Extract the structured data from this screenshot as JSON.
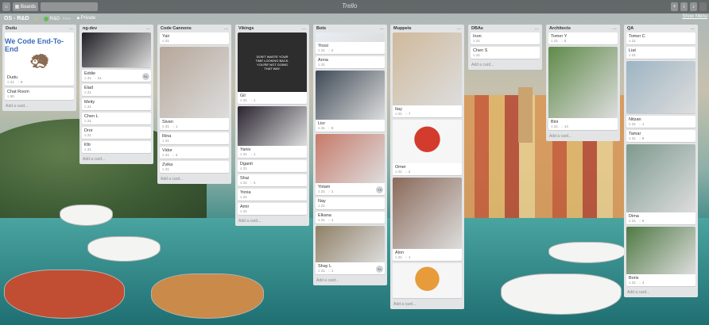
{
  "header": {
    "boards_label": "Boards",
    "logo": "Trello",
    "right_icons": [
      "plus-icon",
      "info-icon",
      "bell-icon",
      "avatar"
    ]
  },
  "board": {
    "title": "OS - R&D",
    "team_label": "R&D",
    "team_plan": "Free",
    "visibility": "Private",
    "show_menu": "Show Menu"
  },
  "lists": [
    {
      "name": "Dudu",
      "cards": [
        {
          "title": "Dudu",
          "badges": [
            "21",
            "9"
          ],
          "cover": {
            "type": "text",
            "text": "We Code End-To-End",
            "height": 0
          }
        },
        {
          "title": "Chat Room",
          "badges": [
            "50"
          ]
        }
      ],
      "add": "Add a card..."
    },
    {
      "name": "ng-dev",
      "cards": [
        {
          "title": "",
          "badges": [],
          "cover": {
            "type": "image",
            "color": "#1f1f24"
          }
        },
        {
          "title": "Eddie",
          "badges": [
            "21",
            "21"
          ],
          "member": "RL"
        },
        {
          "title": "Elad",
          "badges": [
            "21"
          ]
        },
        {
          "title": "Meity",
          "badges": [
            "21"
          ]
        },
        {
          "title": "Chen L",
          "badges": [
            "21"
          ]
        },
        {
          "title": "Dror",
          "badges": [
            "21"
          ]
        },
        {
          "title": "Kfir",
          "badges": [
            "21"
          ]
        }
      ],
      "add": "Add a card..."
    },
    {
      "name": "Code Cannons",
      "cards": [
        {
          "title": "Yair",
          "badges": [
            "21"
          ]
        },
        {
          "title": "Sivan",
          "badges": [
            "21",
            "1"
          ],
          "cover": {
            "type": "image",
            "color": "#b6a79a"
          }
        },
        {
          "title": "Rina",
          "badges": [
            "21"
          ]
        },
        {
          "title": "Vidor",
          "badges": [
            "21",
            "4"
          ]
        },
        {
          "title": "Zvika",
          "badges": [
            "21"
          ]
        }
      ],
      "add": "Add a card..."
    },
    {
      "name": "Vikings",
      "cards": [
        {
          "title": "Gil",
          "badges": [
            "21",
            "1"
          ],
          "cover": {
            "type": "meme",
            "text": "DON'T WASTE YOUR TIME LOOKING BACK. YOU'RE NOT GOING THAT WAY.",
            "color": "#2d2d2d"
          }
        },
        {
          "title": "Yaniv",
          "badges": [
            "21",
            "1"
          ],
          "cover": {
            "type": "image",
            "color": "#2a2430"
          }
        },
        {
          "title": "Dganit",
          "badges": [
            "21"
          ]
        },
        {
          "title": "Shai",
          "badges": [
            "21",
            "4"
          ]
        },
        {
          "title": "Yonia",
          "badges": [
            "21"
          ]
        },
        {
          "title": "Amir",
          "badges": [
            "21"
          ]
        }
      ],
      "add": "Add a card..."
    },
    {
      "name": "Bots",
      "cards": [
        {
          "title": "Yossi",
          "badges": [
            "21",
            "2"
          ],
          "cover": {
            "type": "image",
            "color": "#e9eef5"
          }
        },
        {
          "title": "Anna",
          "badges": [
            "21"
          ]
        },
        {
          "title": "Lior",
          "badges": [
            "21",
            "5"
          ],
          "cover": {
            "type": "image",
            "color": "#3e4a56"
          }
        },
        {
          "title": "Yotam",
          "badges": [
            "21",
            "1"
          ],
          "member": "YS",
          "cover": {
            "type": "image",
            "color": "#c77a6a"
          }
        },
        {
          "title": "Nay",
          "badges": [
            "21"
          ]
        },
        {
          "title": "Elkana",
          "badges": [
            "21",
            "1"
          ]
        },
        {
          "title": "Shay L",
          "badges": [
            "21",
            "1"
          ],
          "member": "SL",
          "cover": {
            "type": "image",
            "color": "#8f8066"
          }
        }
      ],
      "add": "Add a card..."
    },
    {
      "name": "Muppets",
      "cards": [
        {
          "title": "Itay",
          "badges": [
            "21",
            "7"
          ],
          "cover": {
            "type": "image",
            "color": "#cfb99b"
          }
        },
        {
          "title": "Omer",
          "badges": [
            "21",
            "2"
          ],
          "cover": {
            "type": "muppet",
            "color": "#d33b2c"
          }
        },
        {
          "title": "Alon",
          "badges": [
            "21",
            "1"
          ],
          "cover": {
            "type": "image",
            "color": "#8a6a5a"
          }
        },
        {
          "title": "",
          "badges": [],
          "cover": {
            "type": "muppet",
            "color": "#e89b3b"
          }
        }
      ],
      "add": "Add a card..."
    },
    {
      "name": "DBAs",
      "cards": [
        {
          "title": "Inon",
          "badges": [
            "21"
          ]
        },
        {
          "title": "Chen S",
          "badges": [
            "21"
          ]
        }
      ],
      "add": "Add a card..."
    },
    {
      "name": "Architects",
      "cards": [
        {
          "title": "Tomer Y",
          "badges": [
            "21",
            "5"
          ]
        },
        {
          "title": "Bini",
          "badges": [
            "21",
            "14"
          ],
          "cover": {
            "type": "image",
            "color": "#5f8a4a"
          }
        }
      ],
      "add": "Add a card..."
    },
    {
      "name": "QA",
      "cards": [
        {
          "title": "Tomer C",
          "badges": [
            "21"
          ]
        },
        {
          "title": "Liat",
          "badges": [
            "21"
          ]
        },
        {
          "title": "",
          "badges": [],
          "cover": {
            "type": "image",
            "color": "#9db4c3"
          }
        },
        {
          "title": "Nitzan",
          "badges": [
            "21",
            "1"
          ]
        },
        {
          "title": "Tamar",
          "badges": [
            "21",
            "8"
          ]
        },
        {
          "title": "Dima",
          "badges": [
            "21",
            "8"
          ],
          "cover": {
            "type": "image",
            "color": "#7e9a8f"
          }
        },
        {
          "title": "Boris",
          "badges": [
            "21",
            "4"
          ],
          "cover": {
            "type": "image",
            "color": "#4f7a44"
          }
        }
      ],
      "add": "Add a card..."
    }
  ]
}
